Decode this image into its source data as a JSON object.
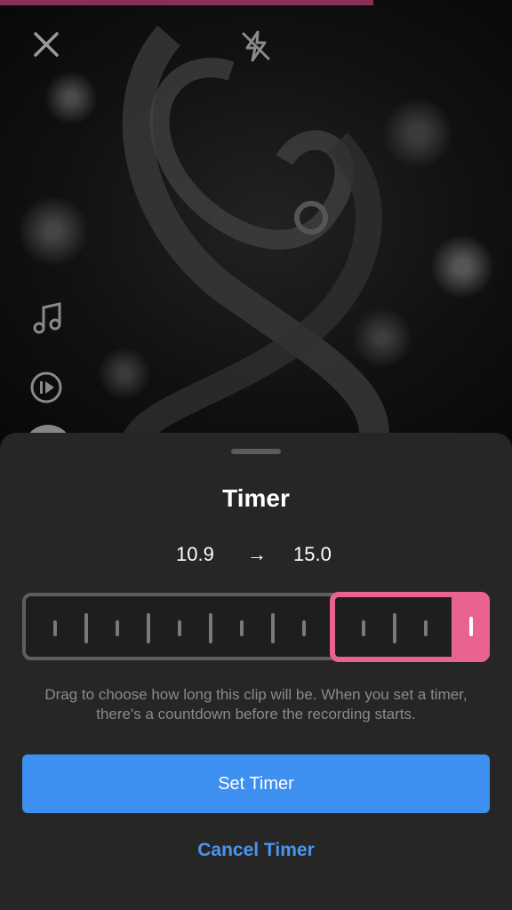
{
  "camera": {
    "icons": {
      "close": "close-icon",
      "flash_off": "flash-off-icon",
      "music": "music-note-icon",
      "speed": "play-speed-icon"
    }
  },
  "timer_sheet": {
    "title": "Timer",
    "range": {
      "start": "10.9",
      "arrow": "→",
      "end": "15.0"
    },
    "description": "Drag to choose how long this clip will be. When you set a timer, there's a countdown before the recording starts.",
    "set_button_label": "Set Timer",
    "cancel_button_label": "Cancel Timer"
  },
  "colors": {
    "accent_pink": "#e8648f",
    "primary_blue": "#3d8ff0",
    "sheet_bg": "#262626"
  }
}
